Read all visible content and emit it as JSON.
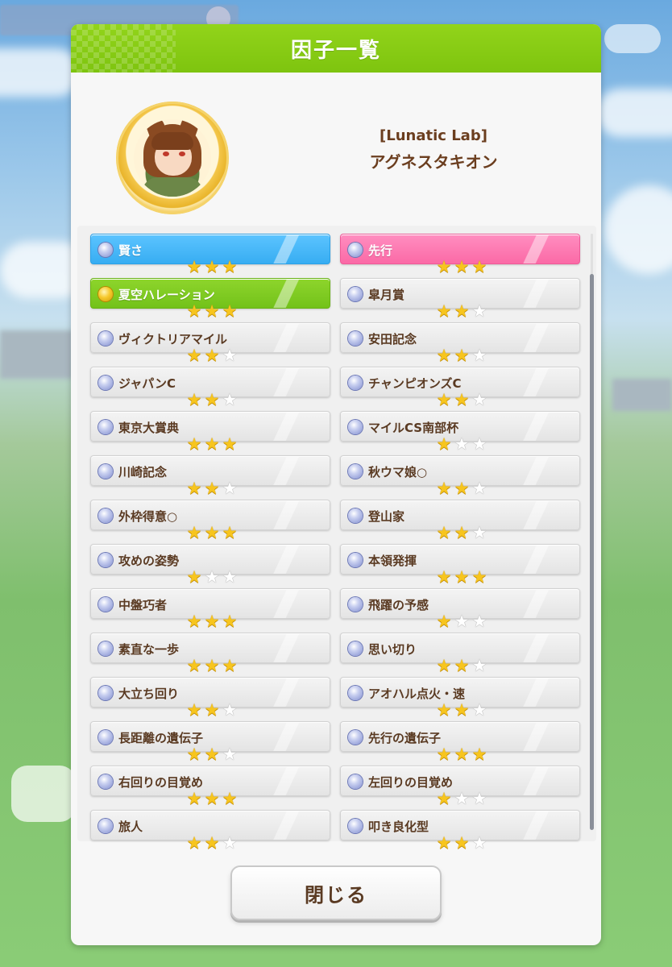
{
  "background": {
    "topbar_text": "",
    "right_button_text": "",
    "left_button_text": ""
  },
  "dialog": {
    "title": "因子一覧",
    "close_label": "閉じる"
  },
  "character": {
    "title": "[Lunatic Lab]",
    "name": "アグネスタキオン"
  },
  "colors": {
    "header_green": "#7ec40f",
    "blue_factor": "#37adf2",
    "pink_factor": "#fb6aa6",
    "green_factor": "#73c21a",
    "star_gold": "#f7c51e",
    "text_brown": "#5a3a22"
  },
  "icons": {
    "factor_dot": "round-gem-icon",
    "star": "star-icon"
  },
  "factors_left": [
    {
      "label": "賢さ",
      "stars": 3,
      "type": "blue",
      "dot": "silver"
    },
    {
      "label": "夏空ハレーション",
      "stars": 3,
      "type": "green",
      "dot": "gold"
    },
    {
      "label": "ヴィクトリアマイル",
      "stars": 2,
      "type": "white",
      "dot": "silver"
    },
    {
      "label": "ジャパンC",
      "stars": 2,
      "type": "white",
      "dot": "silver"
    },
    {
      "label": "東京大賞典",
      "stars": 3,
      "type": "white",
      "dot": "silver"
    },
    {
      "label": "川崎記念",
      "stars": 2,
      "type": "white",
      "dot": "silver"
    },
    {
      "label": "外枠得意○",
      "stars": 3,
      "type": "white",
      "dot": "silver"
    },
    {
      "label": "攻めの姿勢",
      "stars": 1,
      "type": "white",
      "dot": "silver"
    },
    {
      "label": "中盤巧者",
      "stars": 3,
      "type": "white",
      "dot": "silver"
    },
    {
      "label": "素直な一歩",
      "stars": 3,
      "type": "white",
      "dot": "silver"
    },
    {
      "label": "大立ち回り",
      "stars": 2,
      "type": "white",
      "dot": "silver"
    },
    {
      "label": "長距離の遺伝子",
      "stars": 2,
      "type": "white",
      "dot": "silver"
    },
    {
      "label": "右回りの目覚め",
      "stars": 3,
      "type": "white",
      "dot": "silver"
    },
    {
      "label": "旅人",
      "stars": 2,
      "type": "white",
      "dot": "silver"
    }
  ],
  "factors_right": [
    {
      "label": "先行",
      "stars": 3,
      "type": "pink",
      "dot": "silver"
    },
    {
      "label": "皐月賞",
      "stars": 2,
      "type": "white",
      "dot": "silver"
    },
    {
      "label": "安田記念",
      "stars": 2,
      "type": "white",
      "dot": "silver"
    },
    {
      "label": "チャンピオンズC",
      "stars": 2,
      "type": "white",
      "dot": "silver"
    },
    {
      "label": "マイルCS南部杯",
      "stars": 1,
      "type": "white",
      "dot": "silver"
    },
    {
      "label": "秋ウマ娘○",
      "stars": 2,
      "type": "white",
      "dot": "silver"
    },
    {
      "label": "登山家",
      "stars": 2,
      "type": "white",
      "dot": "silver"
    },
    {
      "label": "本領発揮",
      "stars": 3,
      "type": "white",
      "dot": "silver"
    },
    {
      "label": "飛躍の予感",
      "stars": 1,
      "type": "white",
      "dot": "silver"
    },
    {
      "label": "思い切り",
      "stars": 2,
      "type": "white",
      "dot": "silver"
    },
    {
      "label": "アオハル点火・速",
      "stars": 2,
      "type": "white",
      "dot": "silver"
    },
    {
      "label": "先行の遺伝子",
      "stars": 3,
      "type": "white",
      "dot": "silver"
    },
    {
      "label": "左回りの目覚め",
      "stars": 1,
      "type": "white",
      "dot": "silver"
    },
    {
      "label": "叩き良化型",
      "stars": 2,
      "type": "white",
      "dot": "silver"
    }
  ]
}
